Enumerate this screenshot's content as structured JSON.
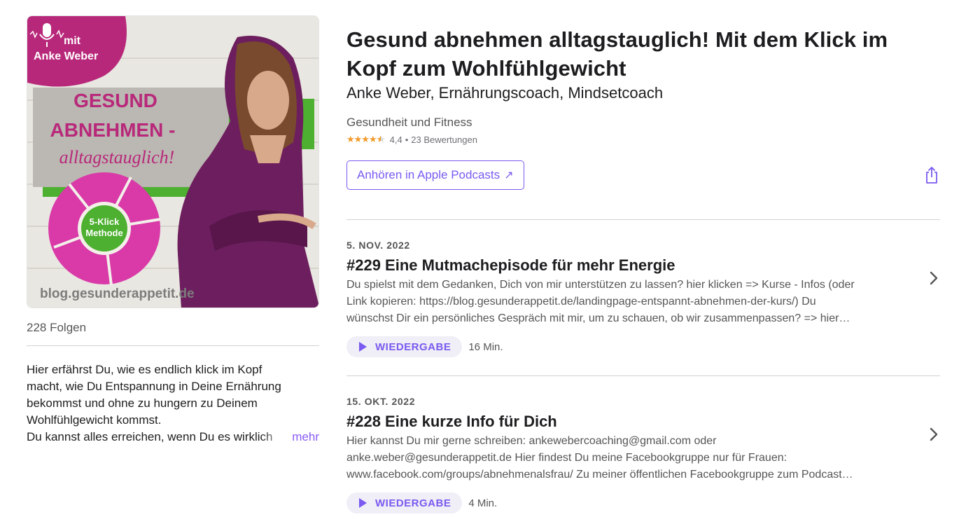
{
  "podcast": {
    "title": "Gesund abnehmen alltagstauglich! Mit dem Klick im Kopf zum Wohlfühlgewicht",
    "author": "Anke Weber, Ernährungscoach, Mindsetcoach",
    "category": "Gesundheit und Fitness",
    "rating": "4,4",
    "rating_value": 4.4,
    "rating_separator": "•",
    "rating_count": "23 Bewertungen",
    "listen_label": "Anhören in Apple Podcasts",
    "listen_arrow": "↗",
    "share_icon": "share-icon",
    "accent_color": "#7a5af0",
    "star_color": "#f19a2a"
  },
  "artwork": {
    "mit": "mit",
    "name": "Anke Weber",
    "line1": "GESUND",
    "line2": "ABNEHMEN -",
    "line3": "alltagstauglich!",
    "method1": "5-Klick",
    "method2": "Methode",
    "url": "blog.gesunderappetit.de",
    "brand_color": "#b8287a",
    "green": "#4db030"
  },
  "sidebar": {
    "episodes_count": "228 Folgen",
    "description_lines": [
      "Hier erfährst Du, wie es endlich klick im Kopf",
      "macht, wie Du Entspannung in Deine Ernährung",
      "bekommst und ohne zu hungern zu Deinem",
      "Wohlfühlgewicht kommst.",
      "Du kannst alles erreichen, wenn Du es wirklich"
    ],
    "more_label": "mehr"
  },
  "episodes": [
    {
      "date": "5. NOV. 2022",
      "title": "#229 Eine Mutmachepisode für mehr Energie",
      "desc_lines": [
        "Du spielst mit dem Gedanken, Dich von mir unterstützen zu lassen? hier klicken => Kurse - Infos (oder",
        "Link kopieren: https://blog.gesunderappetit.de/landingpage-entspannt-abnehmen-der-kurs/) Du",
        "wünschst Dir ein persönliches Gespräch mit mir, um zu schauen, ob wir zusammenpassen? => hier…"
      ],
      "play_label": "WIEDERGABE",
      "duration": "16 Min."
    },
    {
      "date": "15. OKT. 2022",
      "title": "#228 Eine kurze Info für Dich",
      "desc_lines": [
        "Hier kannst Du mir gerne schreiben: ankewebercoaching@gmail.com oder",
        "anke.weber@gesunderappetit.de Hier findest Du meine Facebookgruppe nur für Frauen:",
        "www.facebook.com/groups/abnehmenalsfrau/ Zu meiner öffentlichen Facebookgruppe zum Podcast…"
      ],
      "play_label": "WIEDERGABE",
      "duration": "4 Min."
    }
  ]
}
